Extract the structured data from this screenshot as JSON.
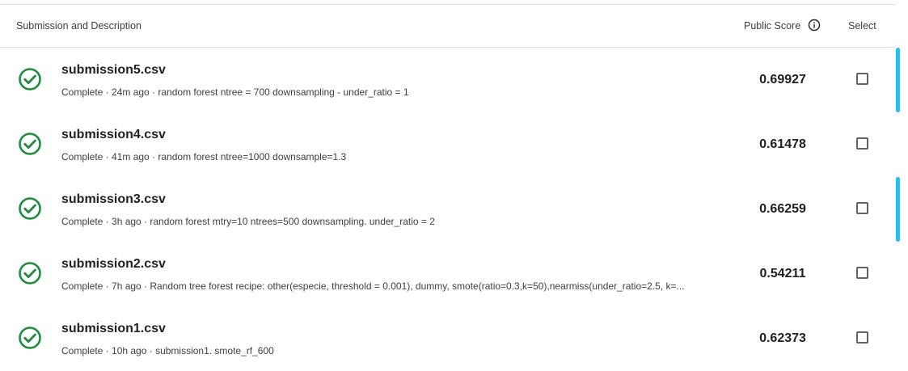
{
  "header": {
    "description_label": "Submission and Description",
    "score_label": "Public Score",
    "select_label": "Select"
  },
  "submissions": [
    {
      "filename": "submission5.csv",
      "status": "Complete",
      "time": "24m ago",
      "description": "random forest ntree = 700 downsampling - under_ratio = 1",
      "meta": "Complete · 24m ago · random forest ntree = 700 downsampling - under_ratio = 1",
      "score": "0.69927",
      "selected": false
    },
    {
      "filename": "submission4.csv",
      "status": "Complete",
      "time": "41m ago",
      "description": "random forest ntree=1000 downsample=1.3",
      "meta": "Complete · 41m ago · random forest ntree=1000 downsample=1.3",
      "score": "0.61478",
      "selected": false
    },
    {
      "filename": "submission3.csv",
      "status": "Complete",
      "time": "3h ago",
      "description": "random forest mtry=10 ntrees=500 downsampling. under_ratio = 2",
      "meta": "Complete · 3h ago · random forest mtry=10 ntrees=500 downsampling. under_ratio = 2",
      "score": "0.66259",
      "selected": false
    },
    {
      "filename": "submission2.csv",
      "status": "Complete",
      "time": "7h ago",
      "description": "Random tree forest recipe: other(especie, threshold = 0.001), dummy, smote(ratio=0.3,k=50),nearmiss(under_ratio=2.5, k=...",
      "meta": "Complete · 7h ago · Random tree forest recipe: other(especie, threshold = 0.001), dummy, smote(ratio=0.3,k=50),nearmiss(under_ratio=2.5, k=...",
      "score": "0.54211",
      "selected": false
    },
    {
      "filename": "submission1.csv",
      "status": "Complete",
      "time": "10h ago",
      "description": "submission1. smote_rf_600",
      "meta": "Complete · 10h ago · submission1. smote_rf_600",
      "score": "0.62373",
      "selected": false
    }
  ],
  "icons": {
    "status": "check-circle-icon",
    "info": "info-icon"
  },
  "colors": {
    "success": "#1e8e3e",
    "accent": "#20beff",
    "divider": "#dadce0"
  }
}
